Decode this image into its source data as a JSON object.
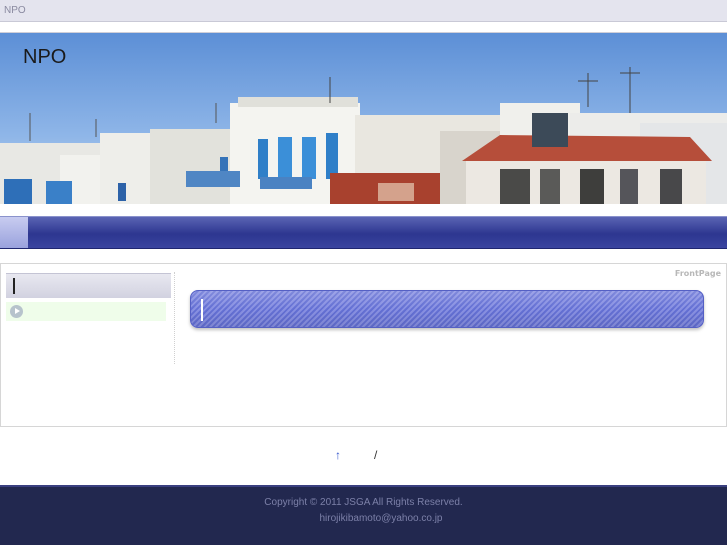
{
  "window": {
    "title": "NPO"
  },
  "header": {
    "site_title": "NPO",
    "banner_image": "whitewashed-harbor-houses-photo"
  },
  "navigation": {
    "active_tab": "home-tab"
  },
  "sidebar": {
    "heading": "",
    "items": [
      {
        "label": "",
        "icon": "circle-play-icon"
      }
    ]
  },
  "main": {
    "breadcrumb": "FrontPage",
    "heading": ""
  },
  "footer_nav": {
    "top_arrow": "↑",
    "separator": "/"
  },
  "footer": {
    "copyright": "Copyright © 2011 JSGA All Rights Reserved.",
    "email": "hirojikibamoto@yahoo.co.jp",
    "background": "#22284f"
  },
  "colors": {
    "nav_blue": "#2d3690",
    "heading_blue": "#6470d4",
    "sidebar_item_bg": "#effdea"
  }
}
